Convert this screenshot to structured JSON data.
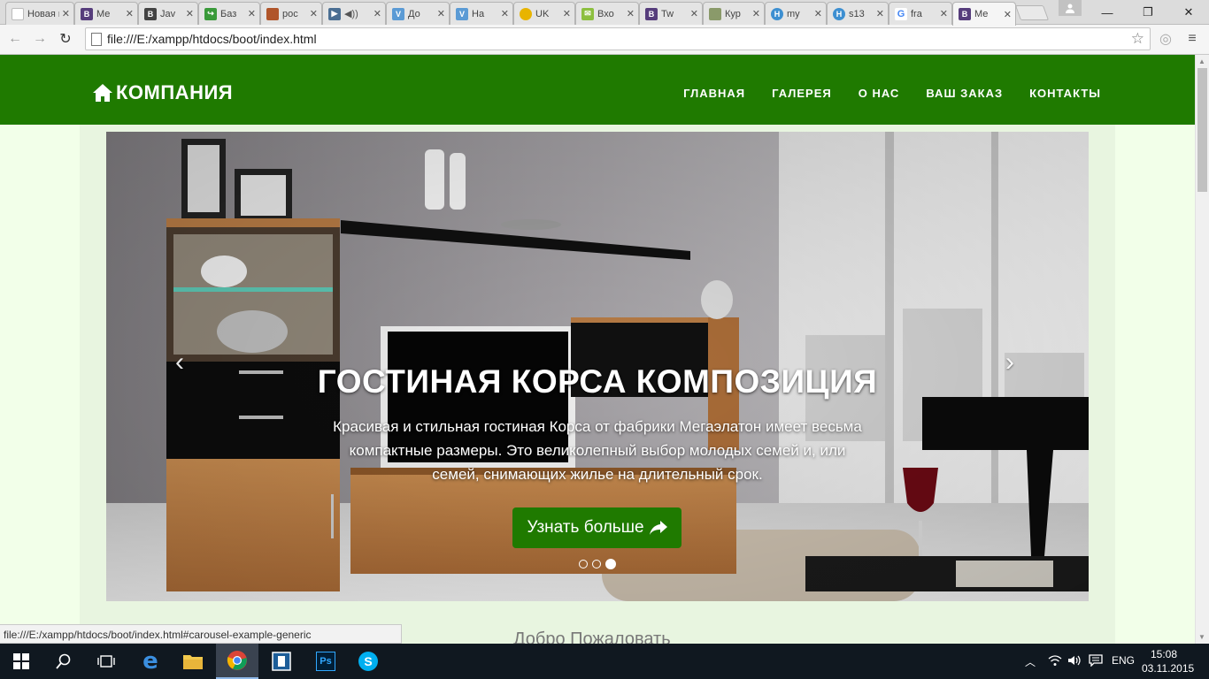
{
  "browser": {
    "tabs": [
      {
        "title": "Новая вкладка",
        "icon": "page-icon",
        "color": "#cccccc",
        "letter": ""
      },
      {
        "title": "Ме",
        "icon": "bootstrap-icon",
        "color": "#563d7c",
        "letter": "B"
      },
      {
        "title": "Jav",
        "icon": "bootstrap-icon",
        "color": "#444444",
        "letter": "B"
      },
      {
        "title": "Баз",
        "icon": "feed-icon",
        "color": "#3a9a3a",
        "letter": ""
      },
      {
        "title": "poc",
        "icon": "squares-icon",
        "color": "#b0552a",
        "letter": ""
      },
      {
        "title": "",
        "icon": "play-icon",
        "color": "#4a6e93",
        "letter": "▶"
      },
      {
        "title": "До",
        "icon": "v-icon",
        "color": "#5b9bd5",
        "letter": "V"
      },
      {
        "title": "На",
        "icon": "v-icon",
        "color": "#5b9bd5",
        "letter": "V"
      },
      {
        "title": "UK",
        "icon": "coin-icon",
        "color": "#e8b400",
        "letter": ""
      },
      {
        "title": "Вхо",
        "icon": "mail-icon",
        "color": "#8cbf3f",
        "letter": ""
      },
      {
        "title": "Tw",
        "icon": "bootstrap-icon",
        "color": "#563d7c",
        "letter": "B"
      },
      {
        "title": "Кур",
        "icon": "book-icon",
        "color": "#8a9a6a",
        "letter": ""
      },
      {
        "title": "my",
        "icon": "h-icon",
        "color": "#3d8fd1",
        "letter": "H"
      },
      {
        "title": "s13",
        "icon": "h-icon",
        "color": "#3d8fd1",
        "letter": "H"
      },
      {
        "title": "fra",
        "icon": "google-icon",
        "color": "#ffffff",
        "letter": "G"
      },
      {
        "title": "Ме",
        "icon": "bootstrap-icon",
        "color": "#563d7c",
        "letter": "B"
      }
    ],
    "url": "file:///E:/xampp/htdocs/boot/index.html",
    "status_url": "file:///E:/xampp/htdocs/boot/index.html#carousel-example-generic"
  },
  "site": {
    "brand": "КОМПАНИЯ",
    "menu": [
      "ГЛАВНАЯ",
      "ГАЛЕРЕЯ",
      "О НАС",
      "ВАШ ЗАКАЗ",
      "КОНТАКТЫ"
    ],
    "slide": {
      "title": "ГОСТИНАЯ КОРСА КОМПОЗИЦИЯ",
      "line1": "Красивая и стильная гостиная Корса от фабрики Мегаэлатон имеет весьма",
      "line2": "компактные размеры. Это великолепный выбор молодых семей и, или",
      "line3": "семей, снимающих жилье на длительный срок.",
      "button": "Узнать больше",
      "indicators": 3,
      "active_indicator": 3
    },
    "welcome": "Добро Пожаловать",
    "colors": {
      "brand_green": "#1f7a00",
      "page_bg": "#f2ffe9"
    }
  },
  "taskbar": {
    "apps": [
      "windows-start-icon",
      "search-icon",
      "task-view-icon",
      "edge-icon",
      "file-explorer-icon",
      "chrome-icon",
      "app-icon",
      "photoshop-icon",
      "skype-icon"
    ],
    "lang": "ENG",
    "time": "15:08",
    "date": "03.11.2015"
  }
}
